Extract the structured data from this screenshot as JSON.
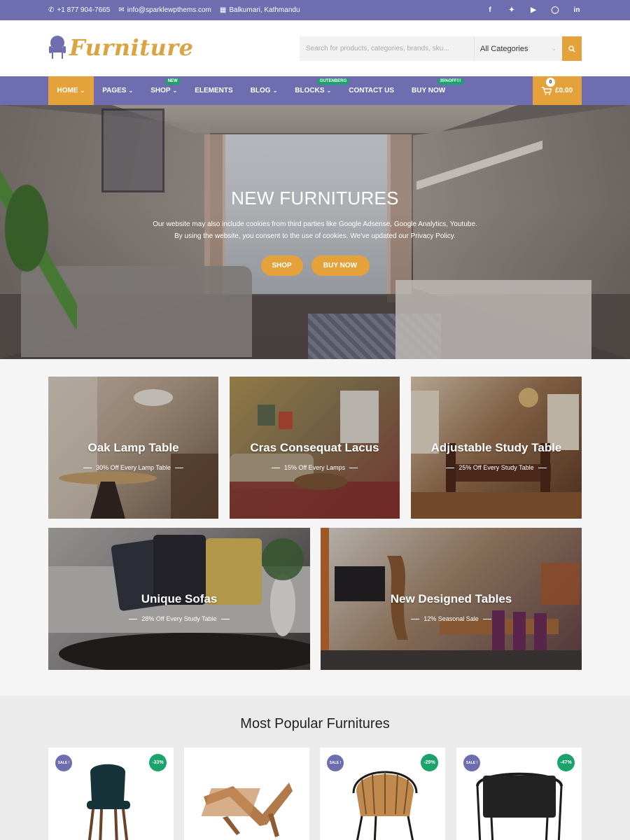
{
  "topbar": {
    "phone": "+1 877 904-7665",
    "email": "info@sparklewpthems.com",
    "location": "Balkumari, Kathmandu",
    "social_icons": [
      "facebook-icon",
      "twitter-icon",
      "youtube-icon",
      "instagram-icon",
      "linkedin-icon"
    ]
  },
  "header": {
    "logo_text": "Furniture",
    "search_placeholder": "Search for products, categories, brands, sku...",
    "category_selected": "All Categories"
  },
  "nav": {
    "items": [
      {
        "label": "Home",
        "active": true,
        "dropdown": true
      },
      {
        "label": "Pages",
        "dropdown": true
      },
      {
        "label": "Shop",
        "dropdown": true,
        "badge": "NEW"
      },
      {
        "label": "Elements"
      },
      {
        "label": "Blog",
        "dropdown": true
      },
      {
        "label": "Blocks",
        "dropdown": true,
        "badge": "GUTENBERG"
      },
      {
        "label": "Contact Us"
      },
      {
        "label": "Buy Now",
        "badge": "35%OFF!!!"
      }
    ],
    "cart_count": "0",
    "cart_total": "£0.00"
  },
  "hero": {
    "title": "NEW FURNITURES",
    "text_line1": "Our website may also include cookies from third parties like Google Adsense, Google Analytics, Youtube.",
    "text_line2": "By using the website, you consent to the use of cookies. We've updated our Privacy Policy.",
    "btn_shop": "SHOP",
    "btn_buy": "BUY NOW"
  },
  "promos": [
    {
      "title": "Oak Lamp Table",
      "subtitle": "30% Off Every Lamp Table"
    },
    {
      "title": "Cras Consequat Lacus",
      "subtitle": "15% Off Every Lamps"
    },
    {
      "title": "Adjustable Study Table",
      "subtitle": "25% Off Every Study Table"
    },
    {
      "title": "Unique Sofas",
      "subtitle": "28% Off Every Study Table"
    },
    {
      "title": "New Designed Tables",
      "subtitle": "12% Seasonal Sale"
    }
  ],
  "popular": {
    "heading": "Most Popular Furnitures",
    "products": [
      {
        "sale": "SALE !",
        "discount": "-33%",
        "image": "dark-bar-stool"
      },
      {
        "sale": "",
        "discount": "",
        "image": "wooden-magazine-rack"
      },
      {
        "sale": "SALE !",
        "discount": "-29%",
        "image": "rattan-chair"
      },
      {
        "sale": "SALE !",
        "discount": "-47%",
        "image": "black-metal-chair"
      }
    ]
  },
  "colors": {
    "primary": "#6d6db0",
    "accent": "#e5a13a",
    "badge_green": "#1ba36c"
  }
}
